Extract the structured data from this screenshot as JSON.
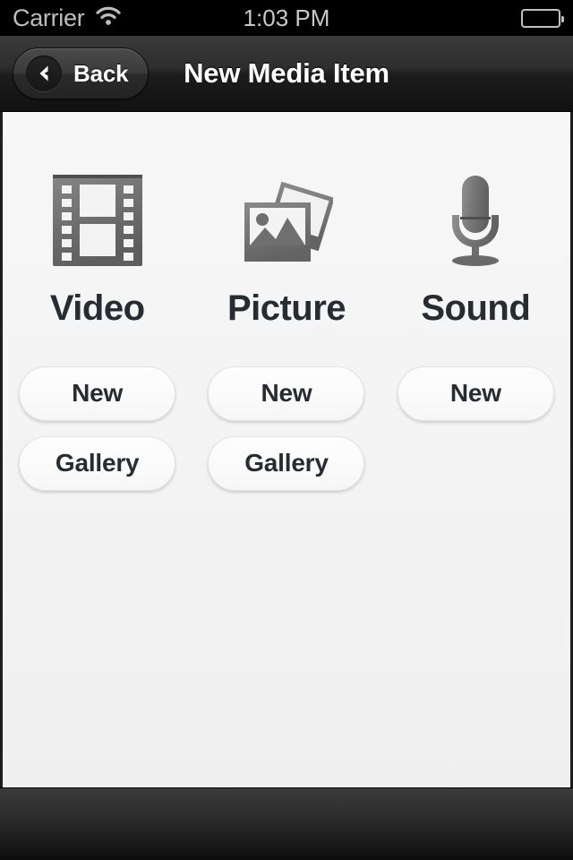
{
  "status_bar": {
    "carrier": "Carrier",
    "wifi_icon": "wifi-icon",
    "time": "1:03 PM",
    "battery_icon": "battery-icon",
    "battery_level": "full"
  },
  "nav_bar": {
    "title": "New Media Item",
    "back_label": "Back",
    "back_icon": "chevron-left-icon"
  },
  "colors": {
    "status_bar_bg": "#000000",
    "nav_bar_bg": "#2b2b2b",
    "content_bg": "#f4f4f4",
    "toolbar_bg": "#222222",
    "text_dark": "#262c31",
    "icon_gray": "#6e6e6e",
    "status_text": "#c0c0c0"
  },
  "main": {
    "columns": [
      {
        "label": "Video",
        "icon": "film-strip-icon",
        "buttons": [
          {
            "label": "New"
          },
          {
            "label": "Gallery"
          }
        ]
      },
      {
        "label": "Picture",
        "icon": "photos-stack-icon",
        "buttons": [
          {
            "label": "New"
          },
          {
            "label": "Gallery"
          }
        ]
      },
      {
        "label": "Sound",
        "icon": "microphone-icon",
        "buttons": [
          {
            "label": "New"
          }
        ]
      }
    ]
  },
  "toolbar": {
    "items": []
  }
}
